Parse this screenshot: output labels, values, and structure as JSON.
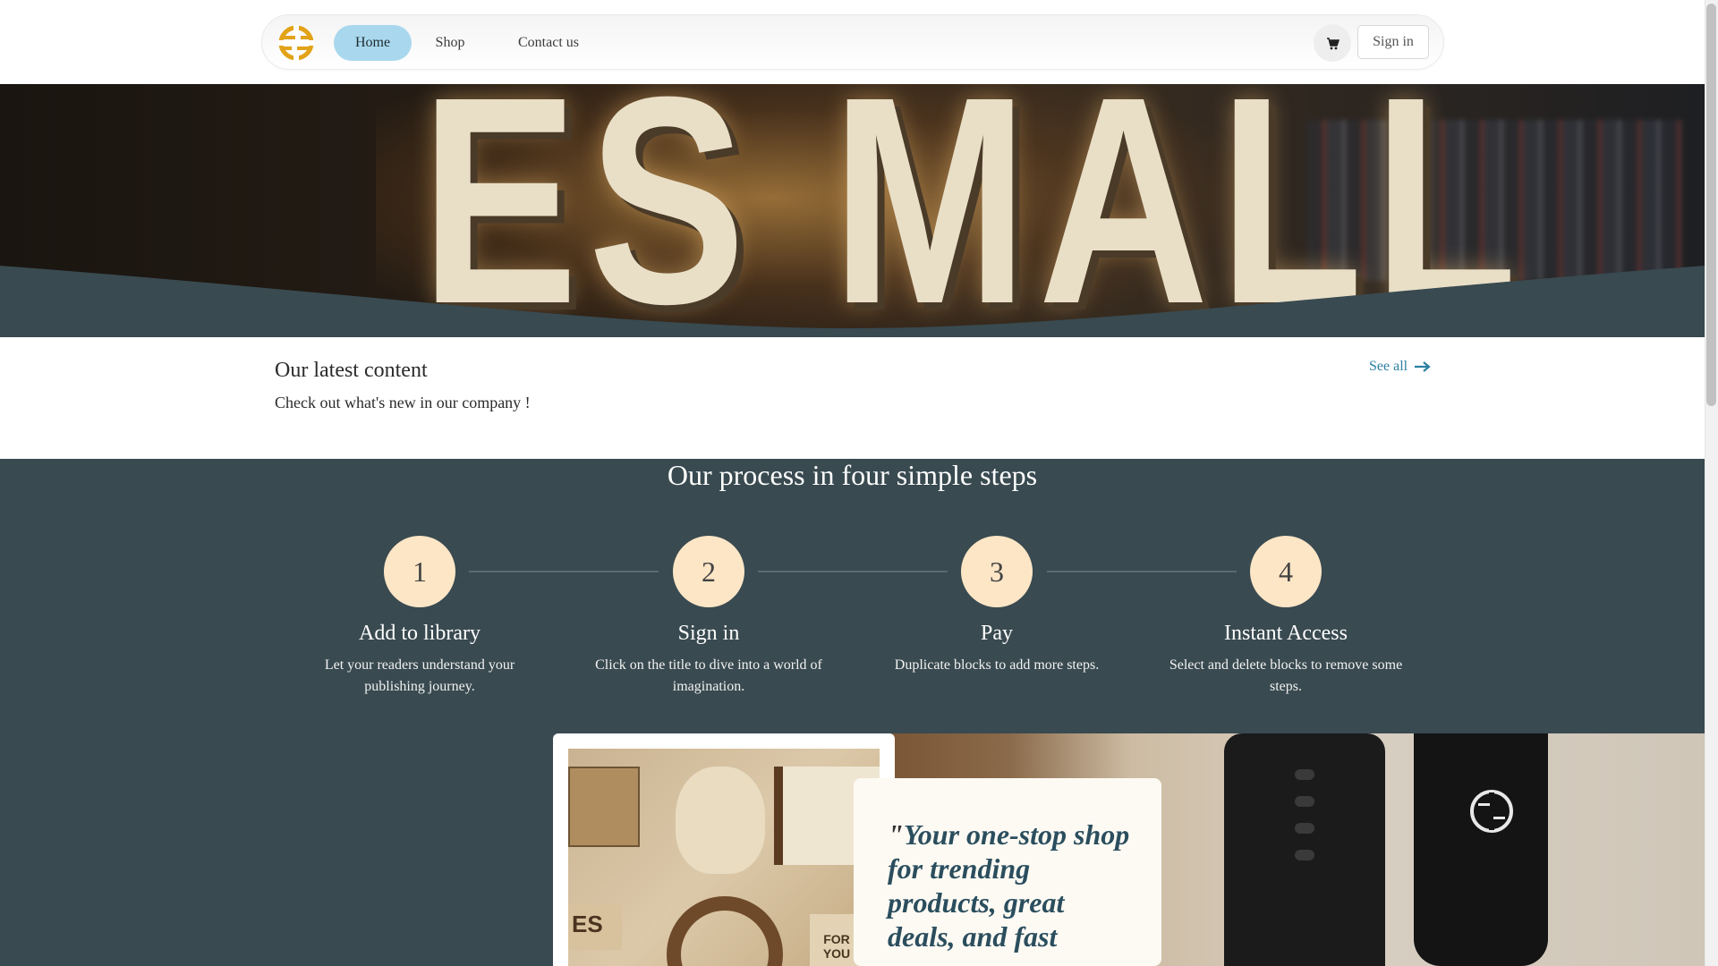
{
  "nav": {
    "home": "Home",
    "shop": "Shop",
    "contact": "Contact us",
    "sign_in": "Sign in"
  },
  "hero": {
    "sign_text": "ES MALL"
  },
  "latest": {
    "title": "Our latest content",
    "subtitle": "Check out what's new in our company !",
    "see_all": "See all"
  },
  "process": {
    "title": "Our process in four simple steps",
    "steps": [
      {
        "num": "1",
        "title": "Add to library",
        "desc": "Let your readers understand your publishing journey."
      },
      {
        "num": "2",
        "title": "Sign in",
        "desc": "Click on the title to dive into a world of imagination."
      },
      {
        "num": "3",
        "title": "Pay",
        "desc": "Duplicate blocks to add more steps."
      },
      {
        "num": "4",
        "title": "Instant Access",
        "desc": "Select and delete blocks to remove some steps."
      }
    ]
  },
  "quote": {
    "open_mark": "\"",
    "text": "Your one-stop shop for trending products, great deals, and fast"
  },
  "colors": {
    "accent": "#a9d8ee",
    "dark": "#394a50",
    "step_circle": "#fde6c6",
    "logo": "#e2a318",
    "link": "#2c7fa3"
  },
  "icons": {
    "cart": "cart-icon",
    "arrow": "arrow-right-icon",
    "logo": "logo-icon"
  }
}
